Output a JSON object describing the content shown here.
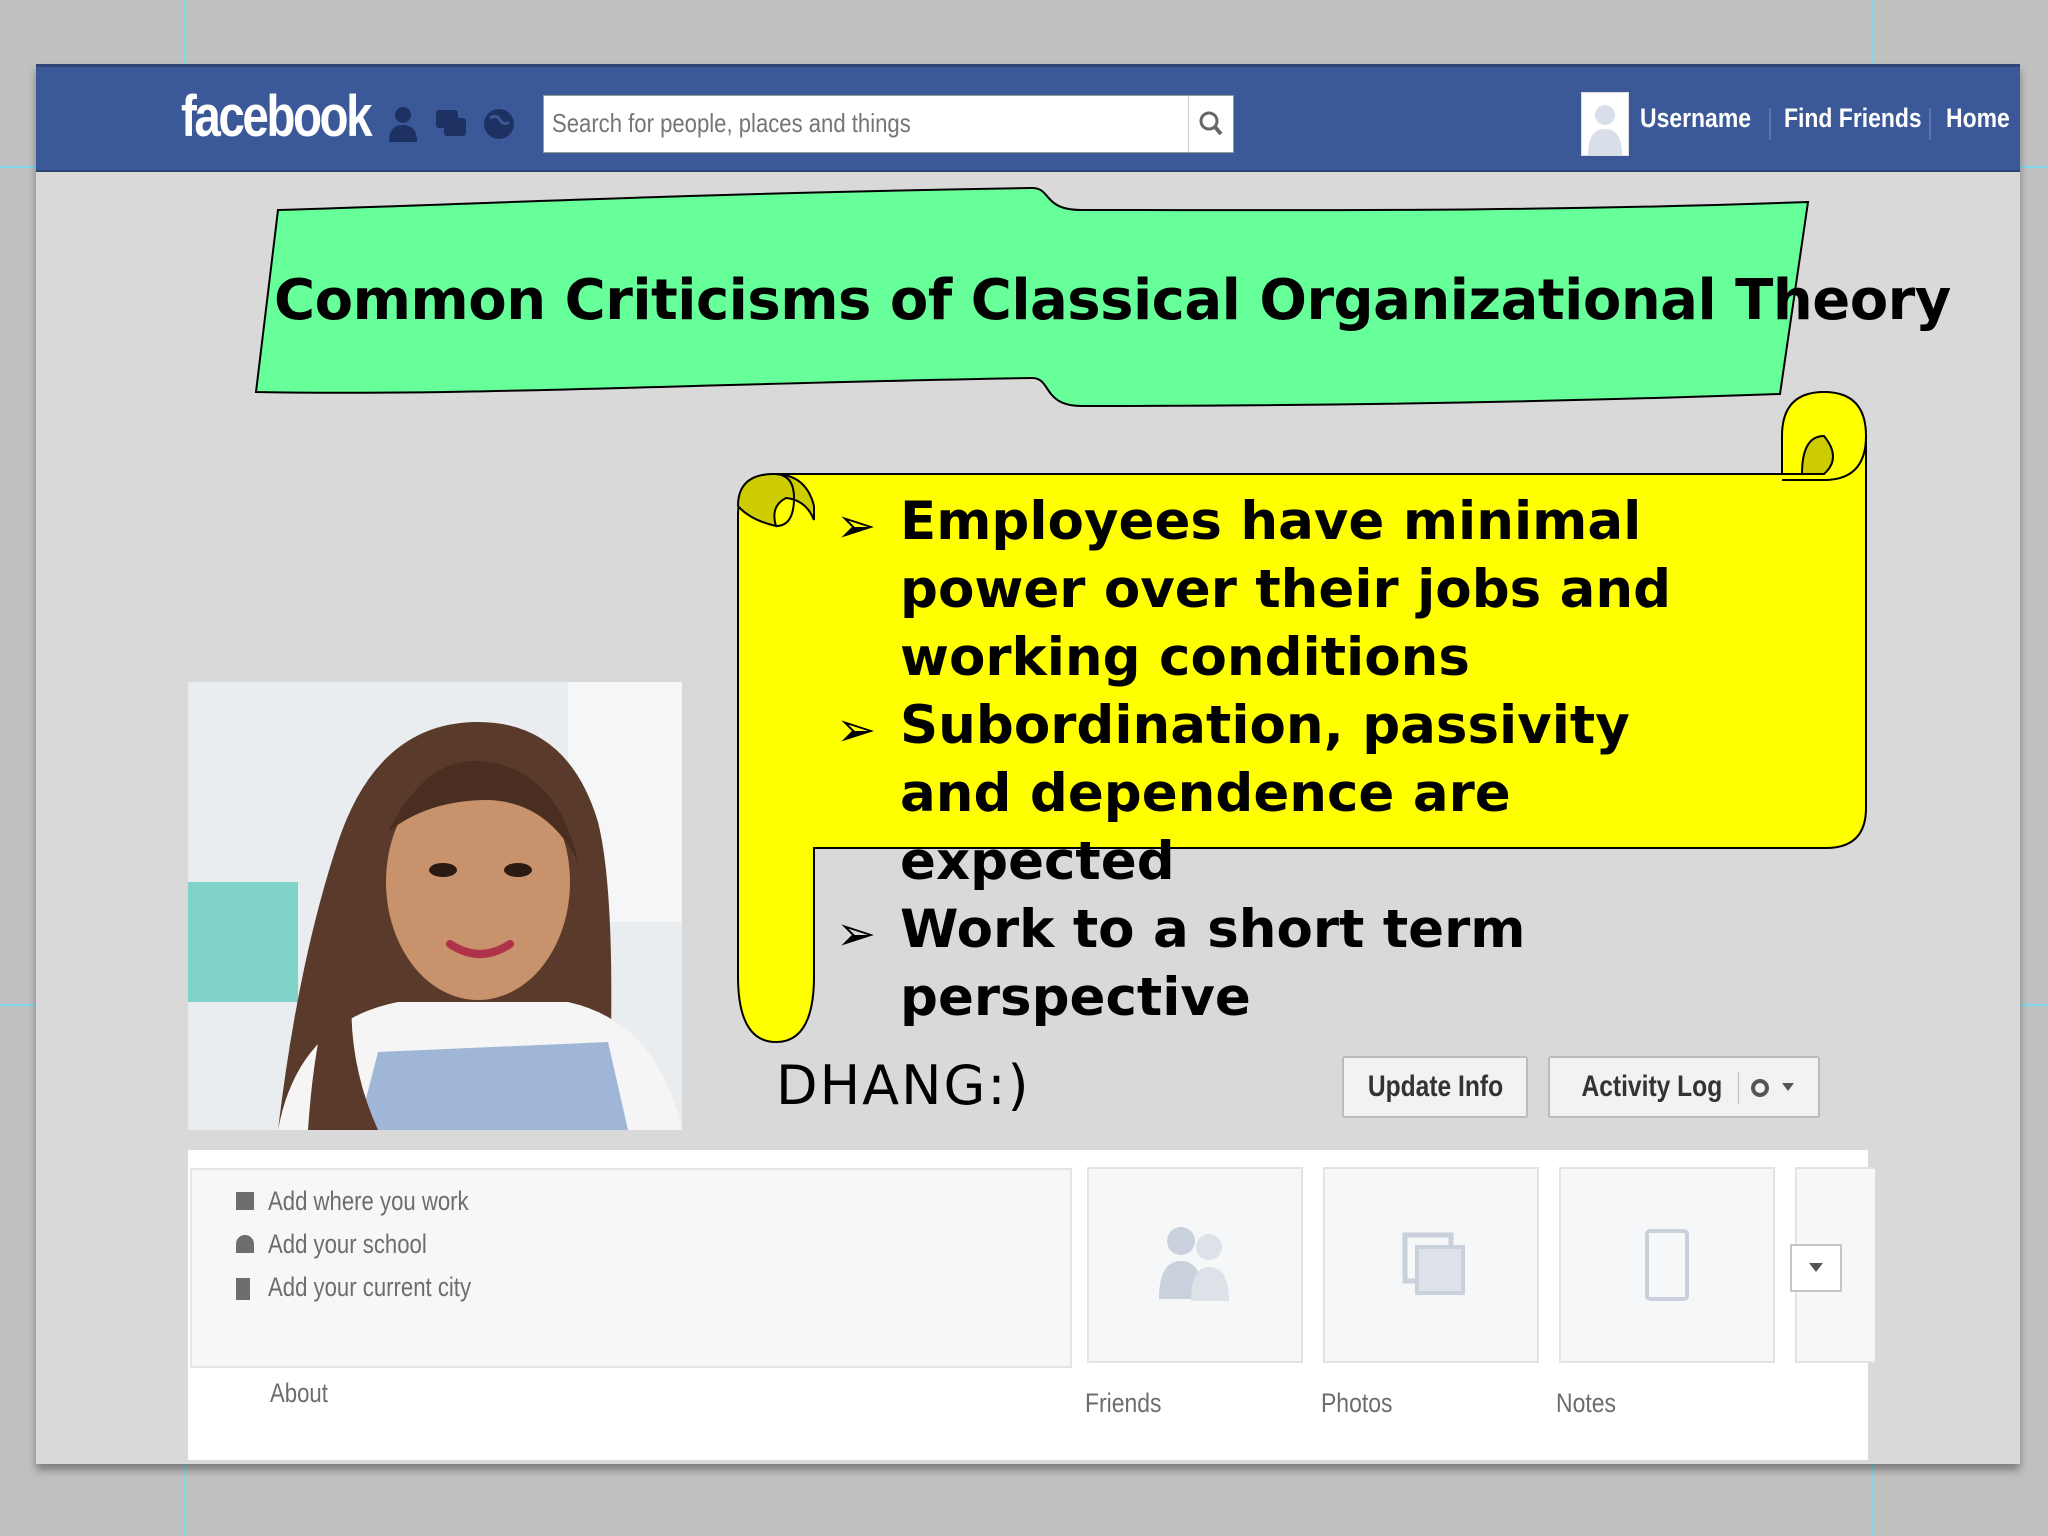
{
  "topbar": {
    "logo": "facebook",
    "search_placeholder": "Search for people, places and things",
    "nav": {
      "username": "Username",
      "find_friends": "Find Friends",
      "home": "Home"
    }
  },
  "slide": {
    "title": "Common Criticisms of Classical Organizational Theory",
    "bullets": [
      "Employees have minimal power over their jobs and working conditions",
      "Subordination, passivity and dependence are expected",
      "Work to a short term perspective"
    ]
  },
  "profile": {
    "name": "DHANG:)",
    "buttons": {
      "update_info": "Update Info",
      "activity_log": "Activity Log"
    }
  },
  "info": {
    "items": [
      "Add where you work",
      "Add your school",
      "Add your current city"
    ],
    "about_label": "About"
  },
  "tiles": {
    "friends": "Friends",
    "photos": "Photos",
    "notes": "Notes"
  },
  "colors": {
    "facebook_blue": "#3b5998",
    "banner_green": "#66ff99",
    "scroll_yellow": "#ffff00"
  }
}
